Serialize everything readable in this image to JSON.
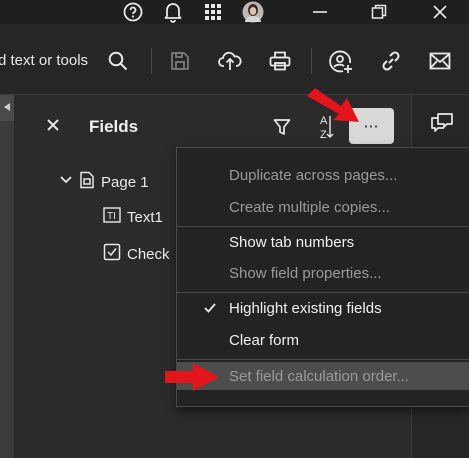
{
  "titlebar": {
    "icons": [
      "help-icon",
      "bell-icon",
      "apps-grid-icon",
      "avatar",
      "minimize-icon",
      "restore-icon",
      "close-icon"
    ]
  },
  "toolbar": {
    "search_text": "d text or tools",
    "icons": [
      "search-icon",
      "save-icon",
      "upload-icon",
      "print-icon",
      "share-user-icon",
      "link-icon",
      "mail-icon"
    ]
  },
  "fields_panel": {
    "title": "Fields",
    "tree": [
      {
        "label": "Page 1",
        "icon": "page-icon"
      },
      {
        "label": "Text1",
        "icon": "text-field-icon"
      },
      {
        "label": "Check",
        "icon": "checkbox-icon"
      }
    ]
  },
  "menu": {
    "items": [
      {
        "label": "Duplicate across pages...",
        "enabled": false
      },
      {
        "label": "Create multiple copies...",
        "enabled": false
      },
      {
        "label": "Show tab numbers",
        "enabled": true
      },
      {
        "label": "Show field properties...",
        "enabled": false
      },
      {
        "label": "Highlight existing fields",
        "enabled": true,
        "checked": true
      },
      {
        "label": "Clear form",
        "enabled": true
      },
      {
        "label": "Set field calculation order...",
        "enabled": false,
        "highlighted": true
      }
    ]
  },
  "colors": {
    "accent_button": "#d9d9d9",
    "annotation_arrow": "#e3141b"
  }
}
